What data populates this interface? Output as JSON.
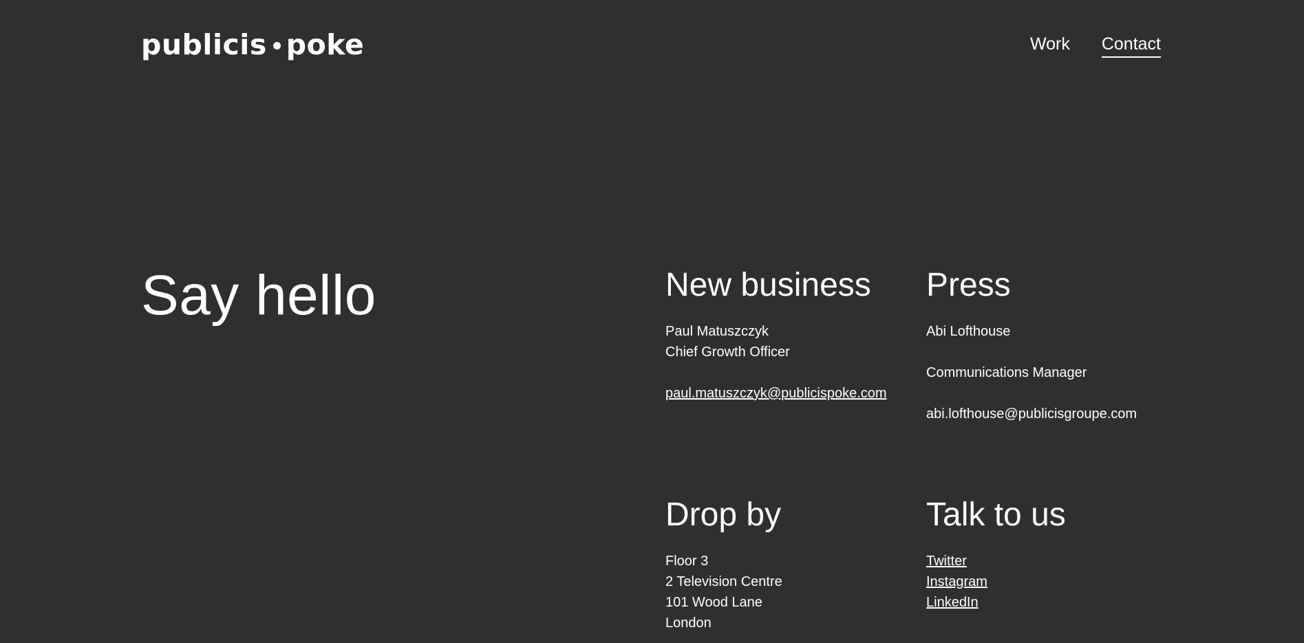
{
  "brand": {
    "logo_left": "publicis",
    "logo_right": "poke"
  },
  "nav": {
    "items": [
      {
        "label": "Work",
        "active": false
      },
      {
        "label": "Contact",
        "active": true
      }
    ]
  },
  "hero": {
    "title": "Say hello"
  },
  "new_business": {
    "heading": "New business",
    "name": "Paul Matuszczyk",
    "role": "Chief Growth Officer",
    "email": "paul.matuszczyk@publicispoke.com"
  },
  "press": {
    "heading": "Press",
    "name": "Abi Lofthouse",
    "role": "Communications Manager",
    "email": "abi.lofthouse@publicisgroupe.com"
  },
  "drop_by": {
    "heading": "Drop by",
    "address": [
      "Floor 3",
      "2 Television Centre",
      "101 Wood Lane",
      "London"
    ]
  },
  "talk_to_us": {
    "heading": "Talk to us",
    "links": [
      "Twitter",
      "Instagram",
      "LinkedIn"
    ]
  },
  "colors": {
    "background": "#2f2f31",
    "text": "#ffffff"
  }
}
